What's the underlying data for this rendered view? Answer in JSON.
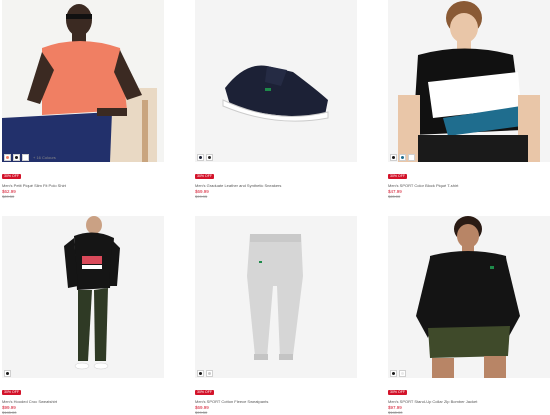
{
  "products": [
    {
      "badge": "30% OFF",
      "name": "Men's Petit Piqué Slim Fit Polo Shirt",
      "sale_price": "$62.99",
      "original_price": "$89.50",
      "color_count": "+ 16 Colours",
      "swatches": [
        "#f07f63",
        "#1a1a1a",
        "#ffffff"
      ],
      "image": "man-coral-polo"
    },
    {
      "badge": "30% OFF",
      "name": "Men's Graduate Leather and Synthetic Sneakers",
      "sale_price": "$69.99",
      "original_price": "$99.95",
      "color_count": "",
      "swatches": [
        "#1a1f33",
        "#2b2b2b"
      ],
      "image": "navy-sneaker"
    },
    {
      "badge": "30% OFF",
      "name": "Men's SPORT Color Block Piqué T-shirt",
      "sale_price": "$47.99",
      "original_price": "$65.00",
      "color_count": "",
      "swatches": [
        "#1a1a1a",
        "#1f6d8e",
        "#ffffff"
      ],
      "image": "man-colorblock-tee"
    },
    {
      "badge": "30% OFF",
      "name": "Men's Hooded Croc Sweatshirt",
      "sale_price": "$99.99",
      "original_price": "$145.00",
      "color_count": "",
      "swatches": [
        "#1a1a1a"
      ],
      "image": "man-black-hoodie"
    },
    {
      "badge": "30% OFF",
      "name": "Men's SPORT Cotton Fleece Sweatpants",
      "sale_price": "$69.99",
      "original_price": "$99.50",
      "color_count": "",
      "swatches": [
        "#1a1a1a",
        "#c8c8c8"
      ],
      "image": "grey-sweatpants"
    },
    {
      "badge": "30% OFF",
      "name": "Men's SPORT Stand-Up Collar Zip Bomber Jacket",
      "sale_price": "$97.99",
      "original_price": "$140.00",
      "color_count": "",
      "swatches": [
        "#1a1a1a",
        "#e9e9e9"
      ],
      "image": "man-black-jacket"
    }
  ],
  "colors": {
    "sale_red": "#d3132a",
    "placeholder_bg": "#f1f1f1"
  }
}
